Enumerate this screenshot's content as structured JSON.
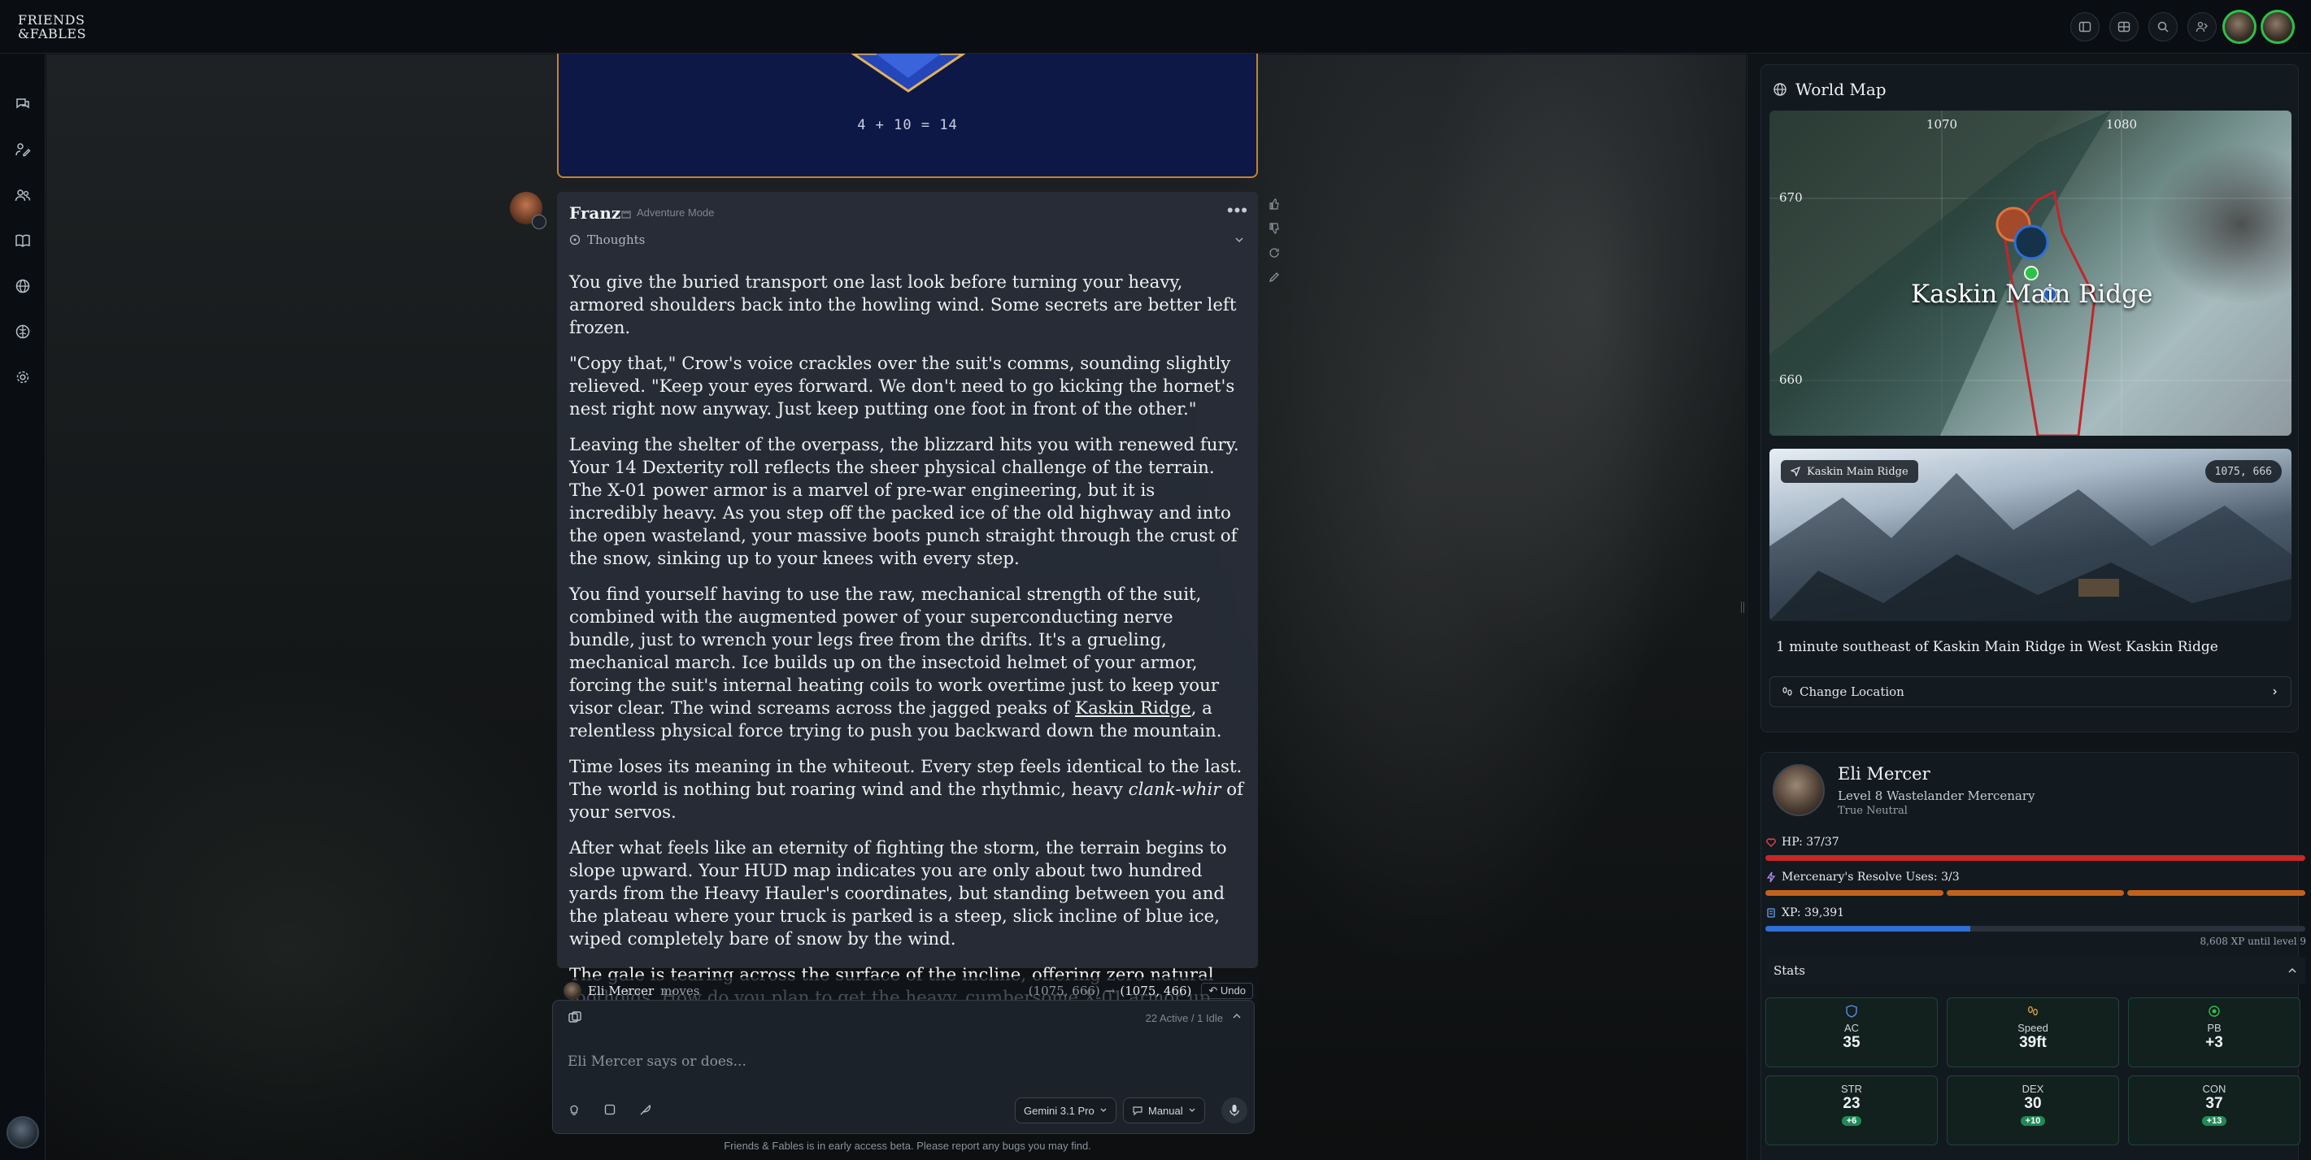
{
  "app": {
    "logo_line1": "FRIENDS",
    "logo_line2": "&FABLES"
  },
  "dice": {
    "formula": "4 + 10 = 14"
  },
  "message": {
    "author": "Franz",
    "mode": "Adventure Mode",
    "thoughts_label": "Thoughts",
    "paragraphs": [
      "You give the buried transport one last look before turning your heavy, armored shoulders back into the howling wind. Some secrets are better left frozen.",
      " \"Copy that,\" Crow's voice crackles over the suit's comms, sounding slightly relieved. \"Keep your eyes forward. We don't need to go kicking the hornet's nest right now anyway. Just keep putting one foot in front of the other.\"",
      "Leaving the shelter of the overpass, the blizzard hits you with renewed fury. Your 14 Dexterity roll reflects the sheer physical challenge of the terrain. The X-01 power armor is a marvel of pre-war engineering, but it is incredibly heavy. As you step off the packed ice of the old highway and into the open wasteland, your massive boots punch straight through the crust of the snow, sinking up to your knees with every step.",
      "You find yourself having to use the raw, mechanical strength of the suit, combined with the augmented power of your superconducting nerve bundle, just to wrench your legs free from the drifts. It's a grueling, mechanical march. Ice builds up on the insectoid helmet of your armor, forcing the suit's internal heating coils to work overtime just to keep your visor clear. The wind screams across the jagged peaks of",
      "a relentless physical force trying to push you backward down the mountain.",
      "Time loses its meaning in the whiteout. Every step feels identical to the last. The world is nothing but roaring wind and the rhythmic, heavy",
      "of your servos.",
      "After what feels like an eternity of fighting the storm, the terrain begins to slope upward. Your HUD map indicates you are only about two hundred yards from the Heavy Hauler's coordinates, but standing between you and the plateau where your truck is parked is a steep, slick incline of blue ice, wiped completely bare of snow by the wind.",
      "The gale is tearing across the surface of the incline, offering zero natural footholds. How do you plan to get the heavy, cumbersome X-01 armor up this sheer, frozen slope to reach your truck?"
    ],
    "link_text": "Kaskin Ridge",
    "italic_text": "clank-whir"
  },
  "move": {
    "actor": "Eli Mercer",
    "verb": "moves",
    "from": "(1075, 666)",
    "arrow": "→",
    "to": "(1075, 466)",
    "undo": "Undo"
  },
  "input": {
    "status": "22 Active / 1 Idle",
    "placeholder": "Eli Mercer says or does...",
    "model": "Gemini 3.1 Pro",
    "mode": "Manual"
  },
  "footer": {
    "note": "Friends & Fables is in early access beta. Please report any bugs you may find."
  },
  "worldmap": {
    "title": "World Map",
    "x_ticks": [
      "1070",
      "1080"
    ],
    "y_ticks": [
      "670",
      "660"
    ],
    "map_label": "Kaskin Main Ridge",
    "location_chip": "Kaskin Main Ridge",
    "coords": "1075, 666",
    "description": "1 minute southeast of Kaskin Main Ridge in West Kaskin Ridge",
    "change_location": "Change Location"
  },
  "character": {
    "name": "Eli Mercer",
    "class": "Level 8 Wastelander Mercenary",
    "alignment": "True Neutral",
    "hp_label": "HP: 37/37",
    "hp_fraction": 1.0,
    "resolve_label": "Mercenary's Resolve Uses: 3/3",
    "resolve_segments": 3,
    "xp_label": "XP: 39,391",
    "xp_fraction": 0.38,
    "xp_note": "8,608 XP until level 9",
    "stats_label": "Stats",
    "core": [
      {
        "label": "AC",
        "value": "35"
      },
      {
        "label": "Speed",
        "value": "39ft"
      },
      {
        "label": "PB",
        "value": "+3"
      }
    ],
    "abilities": [
      {
        "label": "STR",
        "value": "23",
        "mod": "+6"
      },
      {
        "label": "DEX",
        "value": "30",
        "mod": "+10"
      },
      {
        "label": "CON",
        "value": "37",
        "mod": "+13"
      }
    ]
  },
  "colors": {
    "accent_gold": "#c7832a",
    "hp_red": "#c62828",
    "resolve_orange": "#c2611d",
    "xp_blue": "#2f6fd6",
    "online_green": "#2bc24a"
  }
}
